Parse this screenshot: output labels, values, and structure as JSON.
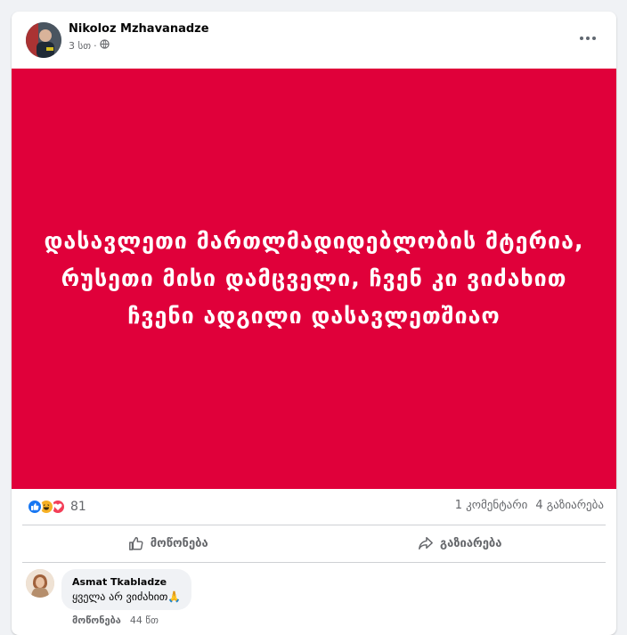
{
  "post": {
    "author": "Nikoloz Mzhavanadze",
    "time": "3 სთ",
    "separator": "·",
    "text": "დასავლეთი მართლმადიდებლობის მტერია, რუსეთი მისი დამცველი, ჩვენ კი ვიძახით ჩვენი ადგილი დასავლეთშიაო",
    "image_bg": "#e0003a",
    "reactions": [
      "like-icon",
      "haha-icon",
      "love-icon"
    ],
    "reaction_count": "81",
    "comments_count": "1 კომენტარი",
    "shares_count": "4 გაზიარება"
  },
  "actions": {
    "like_label": "მოწონება",
    "share_label": "გაზიარება"
  },
  "comment": {
    "author": "Asmat Tkabladze",
    "text": "ყველა არ ვიძახით🙏",
    "like_label": "მოწონება",
    "time": "44 წთ"
  },
  "colors": {
    "background": "#f0f2f5",
    "accent_blue": "#1877f2",
    "love_red": "#f33e58",
    "haha_yellow": "#f7b125",
    "secondary_text": "#65676b"
  }
}
